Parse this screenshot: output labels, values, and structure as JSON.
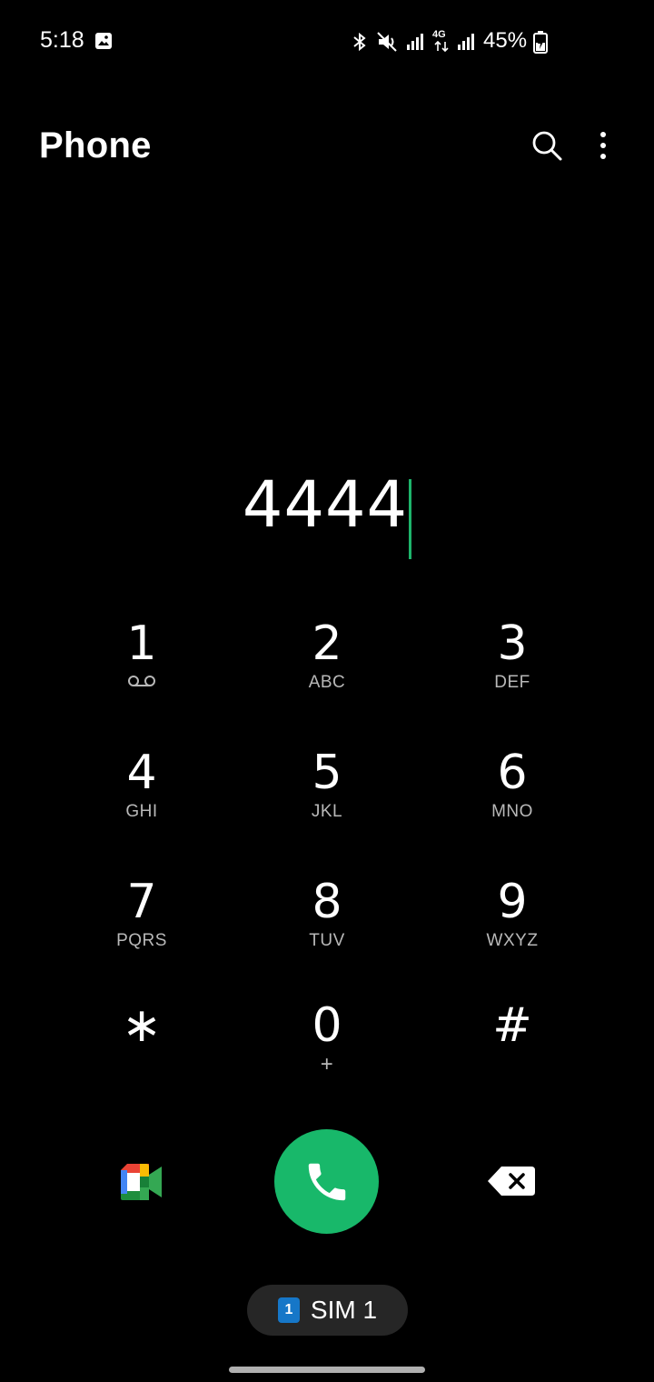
{
  "status_bar": {
    "time": "5:18",
    "battery_percent": "45%",
    "network_label": "4G",
    "icons": [
      "gallery-icon",
      "bluetooth-icon",
      "mute-icon",
      "signal-icon",
      "4g-icon",
      "signal-icon",
      "battery-charging-icon"
    ]
  },
  "header": {
    "title": "Phone",
    "search_icon": "search-icon",
    "more_icon": "more-vert-icon"
  },
  "dialer": {
    "number": "4444"
  },
  "keypad": [
    {
      "digit": "1",
      "letters": "",
      "icon": "voicemail-icon"
    },
    {
      "digit": "2",
      "letters": "ABC"
    },
    {
      "digit": "3",
      "letters": "DEF"
    },
    {
      "digit": "4",
      "letters": "GHI"
    },
    {
      "digit": "5",
      "letters": "JKL"
    },
    {
      "digit": "6",
      "letters": "MNO"
    },
    {
      "digit": "7",
      "letters": "PQRS"
    },
    {
      "digit": "8",
      "letters": "TUV"
    },
    {
      "digit": "9",
      "letters": "WXYZ"
    },
    {
      "digit": "∗",
      "letters": ""
    },
    {
      "digit": "0",
      "letters": "+"
    },
    {
      "digit": "#",
      "letters": ""
    }
  ],
  "actions": {
    "video_call_icon": "google-meet-icon",
    "call_icon": "phone-icon",
    "backspace_icon": "backspace-icon"
  },
  "sim": {
    "badge": "1",
    "label": "SIM 1"
  },
  "colors": {
    "background": "#000000",
    "call_green": "#18b86a",
    "cursor_green": "#1db46b",
    "sim_blue": "#1677c8"
  }
}
